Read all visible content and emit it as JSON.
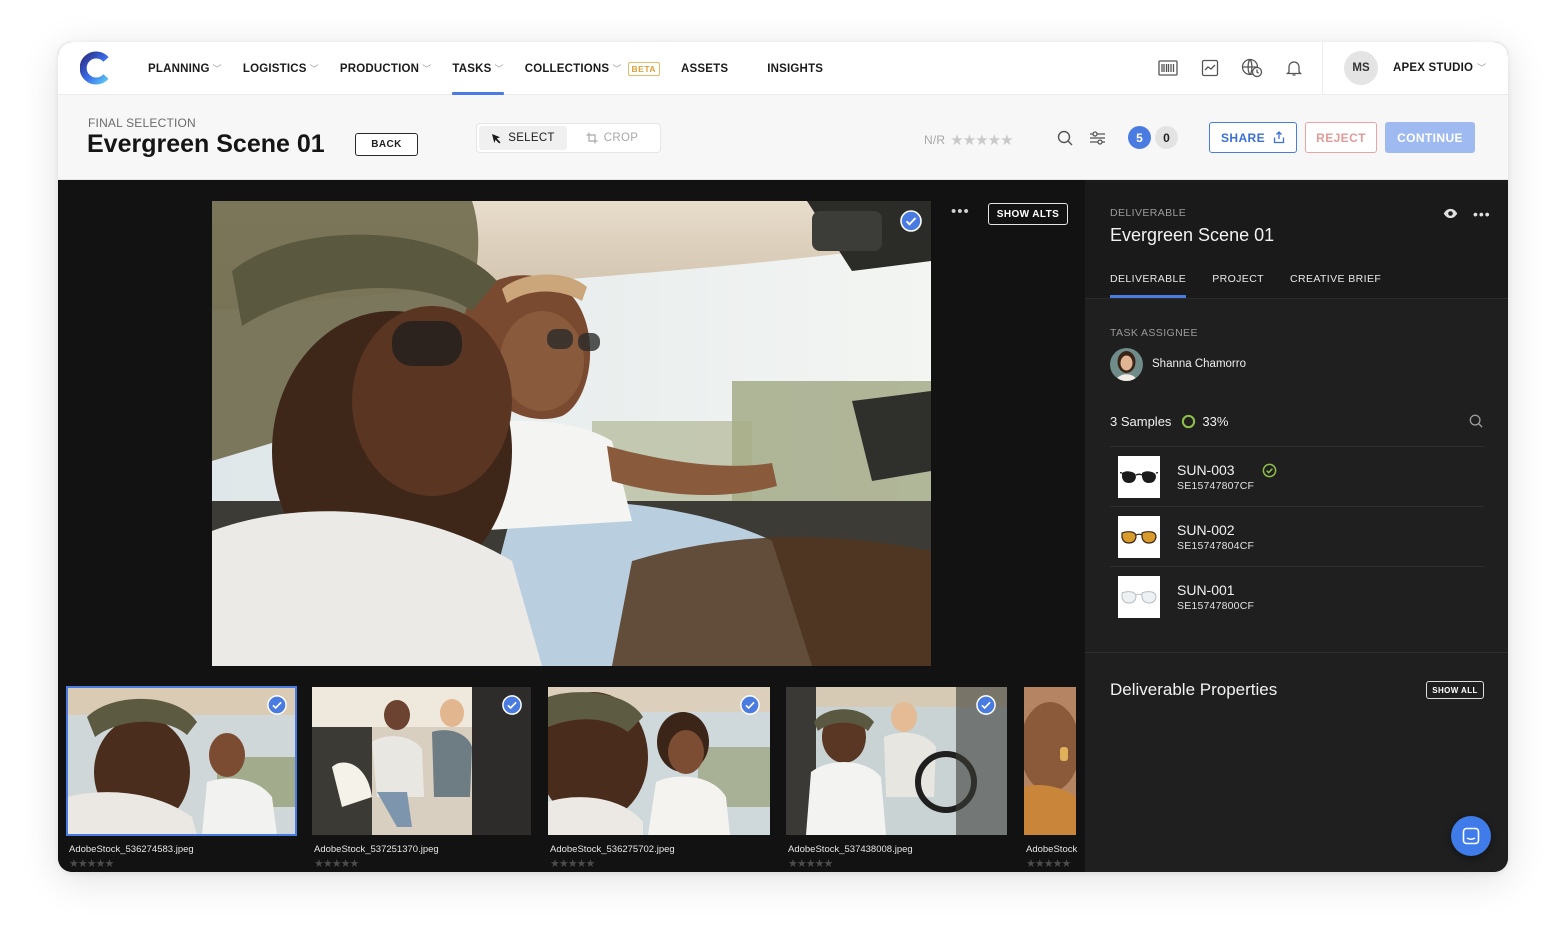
{
  "nav": {
    "items": [
      {
        "label": "PLANNING",
        "chevron": true,
        "active": false
      },
      {
        "label": "LOGISTICS",
        "chevron": true,
        "active": false
      },
      {
        "label": "PRODUCTION",
        "chevron": true,
        "active": false
      },
      {
        "label": "TASKS",
        "chevron": true,
        "active": true
      },
      {
        "label": "COLLECTIONS",
        "chevron": true,
        "active": false,
        "badge": "BETA"
      },
      {
        "label": "ASSETS",
        "chevron": false,
        "active": false
      },
      {
        "label": "INSIGHTS",
        "chevron": false,
        "active": false
      }
    ],
    "icons": [
      "barcode-icon",
      "chart-icon",
      "globe-clock-icon",
      "bell-icon"
    ],
    "user_initials": "MS",
    "studio": "APEX STUDIO"
  },
  "header": {
    "breadcrumb": "FINAL SELECTION",
    "title": "Evergreen Scene 01",
    "back_label": "BACK",
    "select_label": "SELECT",
    "crop_label": "CROP",
    "rating_label": "N/R",
    "rating_stars": "★★★★★",
    "selected_count": "5",
    "rejected_count": "0",
    "share_label": "SHARE",
    "reject_label": "REJECT",
    "continue_label": "CONTINUE"
  },
  "viewer": {
    "more": "•••",
    "show_alts_label": "SHOW ALTS",
    "thumbnails": [
      {
        "filename": "AdobeStock_536274583.jpeg",
        "stars": "★★★★★",
        "checked": true,
        "selected": true
      },
      {
        "filename": "AdobeStock_537251370.jpeg",
        "stars": "★★★★★",
        "checked": true,
        "selected": false
      },
      {
        "filename": "AdobeStock_536275702.jpeg",
        "stars": "★★★★★",
        "checked": true,
        "selected": false
      },
      {
        "filename": "AdobeStock_537438008.jpeg",
        "stars": "★★★★★",
        "checked": true,
        "selected": false
      },
      {
        "filename": "AdobeStock",
        "stars": "★★★★★",
        "checked": false,
        "selected": false
      }
    ]
  },
  "side": {
    "label": "DELIVERABLE",
    "title": "Evergreen Scene 01",
    "more": "•••",
    "tabs": [
      {
        "label": "DELIVERABLE",
        "active": true
      },
      {
        "label": "PROJECT",
        "active": false
      },
      {
        "label": "CREATIVE BRIEF",
        "active": false
      }
    ],
    "assignee_label": "TASK ASSIGNEE",
    "assignee_name": "Shanna Chamorro",
    "samples_label": "3 Samples",
    "samples_progress": "33%",
    "samples_progress_value": 33,
    "samples": [
      {
        "name": "SUN-003",
        "code": "SE15747807CF",
        "approved": true,
        "lens": "dark"
      },
      {
        "name": "SUN-002",
        "code": "SE15747804CF",
        "approved": false,
        "lens": "amber"
      },
      {
        "name": "SUN-001",
        "code": "SE15747800CF",
        "approved": false,
        "lens": "clear"
      }
    ],
    "props_title": "Deliverable Properties",
    "show_all_label": "SHOW ALL"
  },
  "colors": {
    "accent": "#4a7be0",
    "reject": "#e29a9a",
    "beta": "#d9a13b",
    "approved": "#8fbf4a"
  }
}
